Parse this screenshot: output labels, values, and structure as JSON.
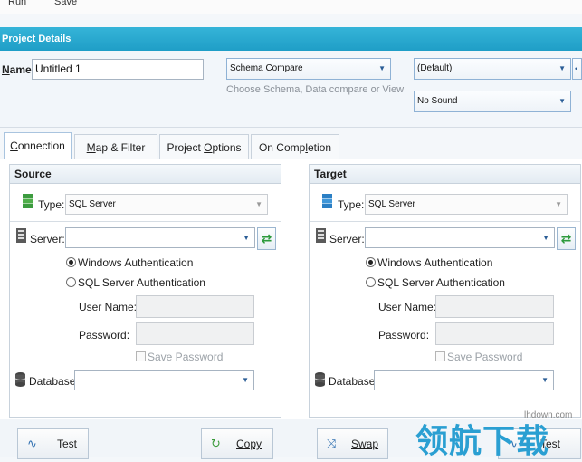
{
  "toolbar": {
    "run_label": "Run",
    "save_label": "Save"
  },
  "header": {
    "title": "Project Details"
  },
  "project": {
    "name_label_u": "N",
    "name_label_rest": "ame:",
    "name_value": "Untitled 1",
    "compare_type_value": "Schema Compare",
    "compare_hint": "Choose Schema, Data compare or View",
    "profile_value": "(Default)",
    "sound_value": "No Sound"
  },
  "tabs": [
    {
      "pre": "",
      "u": "C",
      "post": "onnection"
    },
    {
      "pre": "",
      "u": "M",
      "post": "ap & Filter"
    },
    {
      "pre": "Project ",
      "u": "O",
      "post": "ptions"
    },
    {
      "pre": "On Comp",
      "u": "l",
      "post": "etion"
    }
  ],
  "source": {
    "title": "Source",
    "type_label": "Type:",
    "type_value": "SQL Server",
    "server_label": "Server:",
    "auth_windows": "Windows Authentication",
    "auth_sql": "SQL Server Authentication",
    "username_label": "User Name:",
    "password_label": "Password:",
    "save_password": "Save Password",
    "database_label": "Database:"
  },
  "target": {
    "title": "Target",
    "type_label": "Type:",
    "type_value": "SQL Server",
    "server_label": "Server:",
    "auth_windows": "Windows Authentication",
    "auth_sql": "SQL Server Authentication",
    "username_label": "User Name:",
    "password_label": "Password:",
    "save_password": "Save Password",
    "database_label": "Database:"
  },
  "buttons": {
    "test": "Test",
    "copy": "Copy",
    "swap": "Swap",
    "test2": "Test"
  },
  "watermark": {
    "cn": "领航下载",
    "url": "lhdown.com"
  }
}
